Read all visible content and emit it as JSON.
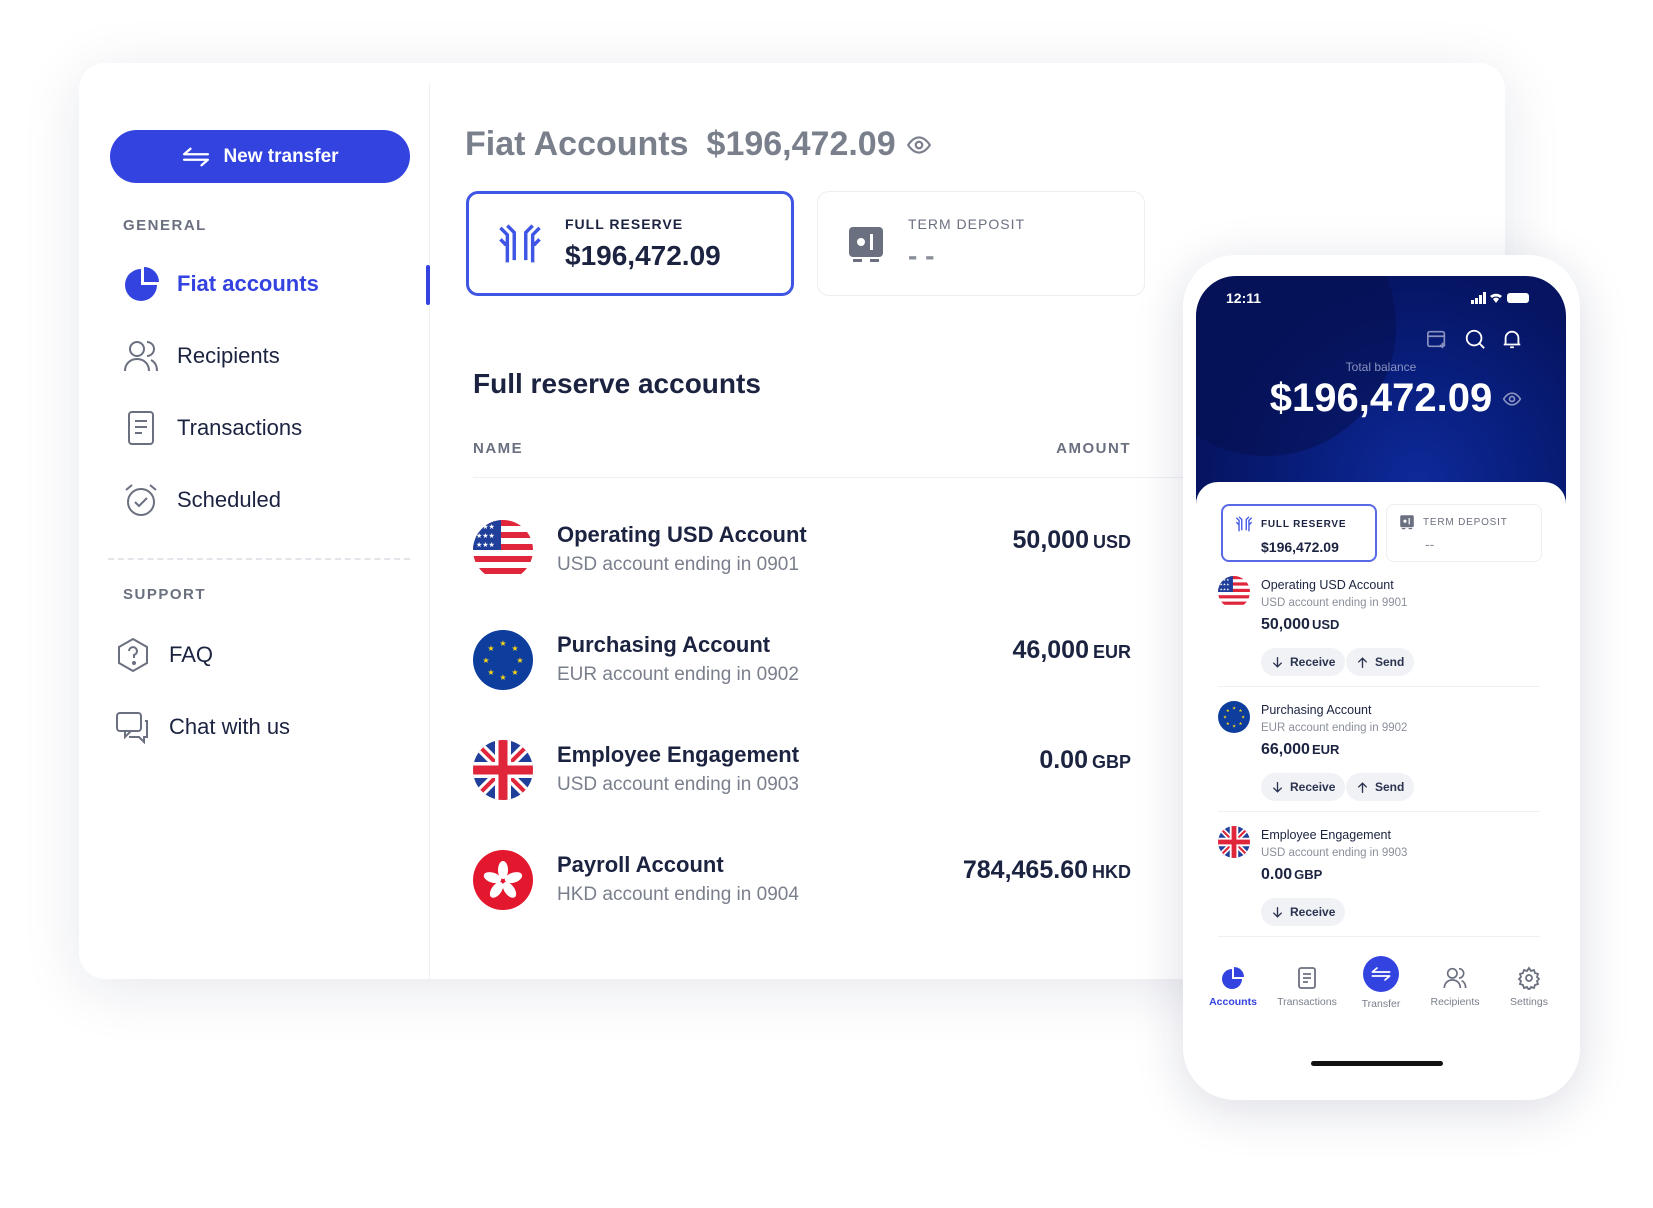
{
  "sidebar": {
    "new_transfer": "New transfer",
    "general_label": "GENERAL",
    "support_label": "SUPPORT",
    "items": [
      {
        "label": "Fiat accounts",
        "icon": "pie-chart-icon"
      },
      {
        "label": "Recipients",
        "icon": "users-icon"
      },
      {
        "label": "Transactions",
        "icon": "document-icon"
      },
      {
        "label": "Scheduled",
        "icon": "alarm-clock-icon"
      }
    ],
    "support_items": [
      {
        "label": "FAQ",
        "icon": "help-icon"
      },
      {
        "label": "Chat with us",
        "icon": "chat-icon"
      }
    ]
  },
  "header": {
    "title": "Fiat Accounts",
    "total": "$196,472.09"
  },
  "cards": [
    {
      "label": "FULL RESERVE",
      "value": "$196,472.09"
    },
    {
      "label": "TERM DEPOSIT",
      "value": "- -"
    }
  ],
  "section_title": "Full reserve accounts",
  "table": {
    "columns": [
      "NAME",
      "AMOUNT"
    ],
    "receive_label": "Receive",
    "rows": [
      {
        "name": "Operating USD Account",
        "sub": "USD account ending in 0901",
        "amount": "50,000",
        "currency": "USD",
        "flag": "us"
      },
      {
        "name": "Purchasing Account",
        "sub": "EUR account ending in 0902",
        "amount": "46,000",
        "currency": "EUR",
        "flag": "eu"
      },
      {
        "name": "Employee Engagement",
        "sub": "USD account ending in 0903",
        "amount": "0.00",
        "currency": "GBP",
        "flag": "uk"
      },
      {
        "name": "Payroll Account",
        "sub": "HKD account ending in 0904",
        "amount": "784,465.60",
        "currency": "HKD",
        "flag": "hk"
      }
    ]
  },
  "phone": {
    "time": "12:11",
    "total_label": "Total balance",
    "total": "$196,472.09",
    "cards": [
      {
        "label": "FULL RESERVE",
        "value": "$196,472.09"
      },
      {
        "label": "TERM DEPOSIT",
        "value": "--"
      }
    ],
    "receive": "Receive",
    "send": "Send",
    "rows": [
      {
        "name": "Operating USD Account",
        "sub": "USD account ending in 9901",
        "amount": "50,000",
        "currency": "USD"
      },
      {
        "name": "Purchasing Account",
        "sub": "EUR account ending in 9902",
        "amount": "66,000",
        "currency": "EUR"
      },
      {
        "name": "Employee Engagement",
        "sub": "USD account ending in 9903",
        "amount": "0.00",
        "currency": "GBP"
      }
    ],
    "nav": [
      "Accounts",
      "Transactions",
      "Transfer",
      "Recipients",
      "Settings"
    ]
  },
  "colors": {
    "accent": "#3343e0",
    "phone_header": "#081d7a"
  }
}
